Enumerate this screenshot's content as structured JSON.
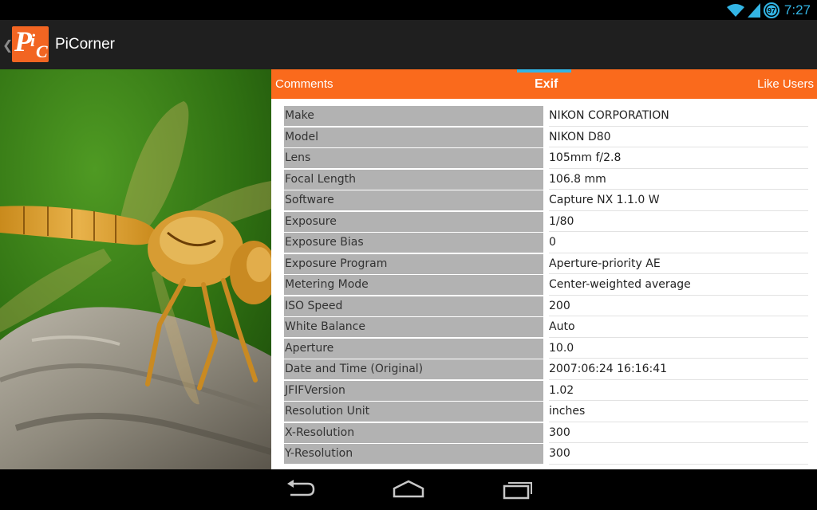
{
  "status": {
    "time": "7:27",
    "battery_level": "97",
    "icons": [
      "wifi-icon",
      "signal-icon",
      "battery-icon"
    ],
    "accent_color": "#33b5e5"
  },
  "actionbar": {
    "logo_letters": [
      "P",
      "i",
      "C"
    ],
    "title": "PiCorner"
  },
  "tabs": [
    {
      "label": "Comments"
    },
    {
      "label": "Exif",
      "selected": true
    },
    {
      "label": "Like Users"
    }
  ],
  "colors": {
    "tab_bar": "#fa6a1c",
    "logo": "#f26522",
    "key_cell": "#b2b2b2"
  },
  "exif": [
    {
      "key": "Make",
      "value": "NIKON CORPORATION"
    },
    {
      "key": "Model",
      "value": "NIKON D80"
    },
    {
      "key": "Lens",
      "value": "105mm f/2.8"
    },
    {
      "key": "Focal Length",
      "value": "106.8 mm"
    },
    {
      "key": "Software",
      "value": "Capture NX 1.1.0 W"
    },
    {
      "key": "Exposure",
      "value": "1/80"
    },
    {
      "key": "Exposure Bias",
      "value": "0"
    },
    {
      "key": "Exposure Program",
      "value": "Aperture-priority AE"
    },
    {
      "key": "Metering Mode",
      "value": "Center-weighted average"
    },
    {
      "key": "ISO Speed",
      "value": "200"
    },
    {
      "key": "White Balance",
      "value": "Auto"
    },
    {
      "key": "Aperture",
      "value": "10.0"
    },
    {
      "key": "Date and Time (Original)",
      "value": "2007:06:24 16:16:41"
    },
    {
      "key": "JFIFVersion",
      "value": "1.02"
    },
    {
      "key": "Resolution Unit",
      "value": "inches"
    },
    {
      "key": "X-Resolution",
      "value": "300"
    },
    {
      "key": "Y-Resolution",
      "value": "300"
    }
  ],
  "navbar": {
    "icons": [
      "back-icon",
      "home-icon",
      "recent-apps-icon"
    ]
  }
}
